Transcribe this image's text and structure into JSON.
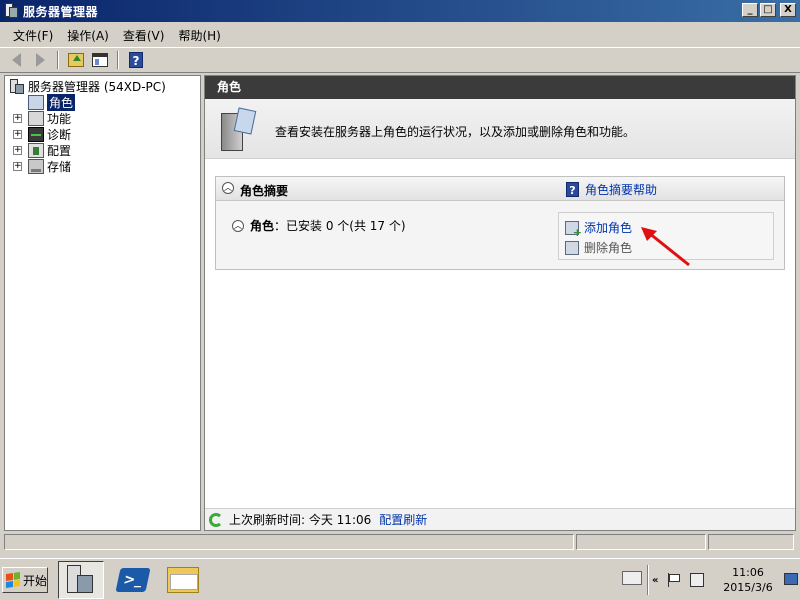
{
  "window": {
    "title": "服务器管理器",
    "buttons": [
      "_",
      "□",
      "X"
    ]
  },
  "menubar": {
    "items": [
      "文件(F)",
      "操作(A)",
      "查看(V)",
      "帮助(H)"
    ]
  },
  "toolbar": {
    "icons": [
      "back-icon",
      "forward-icon",
      "up-level-icon",
      "show-hide-console-tree-icon",
      "help-icon"
    ]
  },
  "tree": {
    "root": "服务器管理器 (54XD-PC)",
    "items": [
      {
        "label": "角色",
        "selected": true,
        "expandable": false
      },
      {
        "label": "功能",
        "selected": false,
        "expandable": true
      },
      {
        "label": "诊断",
        "selected": false,
        "expandable": true
      },
      {
        "label": "配置",
        "selected": false,
        "expandable": true
      },
      {
        "label": "存储",
        "selected": false,
        "expandable": true
      }
    ]
  },
  "content": {
    "header": "角色",
    "intro": "查看安装在服务器上角色的运行状况，以及添加或删除角色和功能。",
    "summary": {
      "title": "角色摘要",
      "help_link": "角色摘要帮助",
      "roles_label": "角色",
      "roles_status": "：已安装 0 个(共 17 个)",
      "actions": {
        "add": "添加角色",
        "remove": "删除角色"
      }
    },
    "status": {
      "last_refresh": "上次刷新时间: 今天 11:06",
      "refresh_link": "配置刷新"
    }
  },
  "taskbar": {
    "start_label": "开始",
    "clock_time": "11:06",
    "clock_date": "2015/3/6",
    "tray_chevron": "«"
  },
  "colors": {
    "titlebar": "#0a246a",
    "content_header": "#3b3b3b",
    "link": "#0033aa",
    "arrow": "#e01010"
  }
}
